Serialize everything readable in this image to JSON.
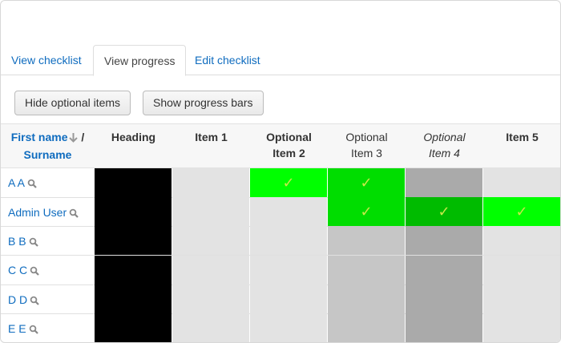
{
  "tabs": [
    {
      "label": "View checklist",
      "active": false
    },
    {
      "label": "View progress",
      "active": true
    },
    {
      "label": "Edit checklist",
      "active": false
    }
  ],
  "buttons": {
    "hide_optional": "Hide optional items",
    "show_progress": "Show progress bars"
  },
  "table": {
    "name_header": {
      "first": "First name",
      "separator": " /",
      "second": "Surname"
    },
    "columns": [
      {
        "label": "Heading",
        "style": "bold"
      },
      {
        "label": "Item 1",
        "style": "bold"
      },
      {
        "label": "Optional Item 2",
        "line1": "Optional",
        "line2": "Item 2",
        "style": "bold"
      },
      {
        "label": "Optional Item 3",
        "line1": "Optional",
        "line2": "Item 3",
        "style": "normal"
      },
      {
        "label": "Optional Item 4",
        "line1": "Optional",
        "line2": "Item 4",
        "style": "italic"
      },
      {
        "label": "Item 5",
        "style": "bold"
      }
    ],
    "rows": [
      {
        "user": "A A",
        "cells": [
          "heading",
          "empty",
          "done",
          "done",
          "empty",
          "empty"
        ]
      },
      {
        "user": "Admin User",
        "cells": [
          "heading",
          "empty",
          "empty",
          "done",
          "done",
          "done"
        ]
      },
      {
        "user": "B B",
        "cells": [
          "heading",
          "empty",
          "empty",
          "empty",
          "empty",
          "empty"
        ]
      },
      {
        "user": "C C",
        "cells": [
          "heading",
          "empty",
          "empty",
          "empty",
          "empty",
          "empty"
        ]
      },
      {
        "user": "D D",
        "cells": [
          "heading",
          "empty",
          "empty",
          "empty",
          "empty",
          "empty"
        ]
      },
      {
        "user": "E E",
        "cells": [
          "heading",
          "empty",
          "empty",
          "empty",
          "empty",
          "empty"
        ]
      }
    ]
  },
  "icons": {
    "sort": "sort-down-arrow-icon",
    "user_info": "magnifier-icon",
    "complete": "checkmark-icon"
  },
  "colors": {
    "link": "#0f6cbf",
    "heading_cell": "#000000",
    "done_bright": "#00ff00",
    "done_medium": "#00dd00",
    "done_dark": "#00bb00",
    "empty_light": "#e3e3e3",
    "empty_mid": "#c6c6c6",
    "empty_dark": "#aaaaaa",
    "check": "#c8e84a"
  }
}
